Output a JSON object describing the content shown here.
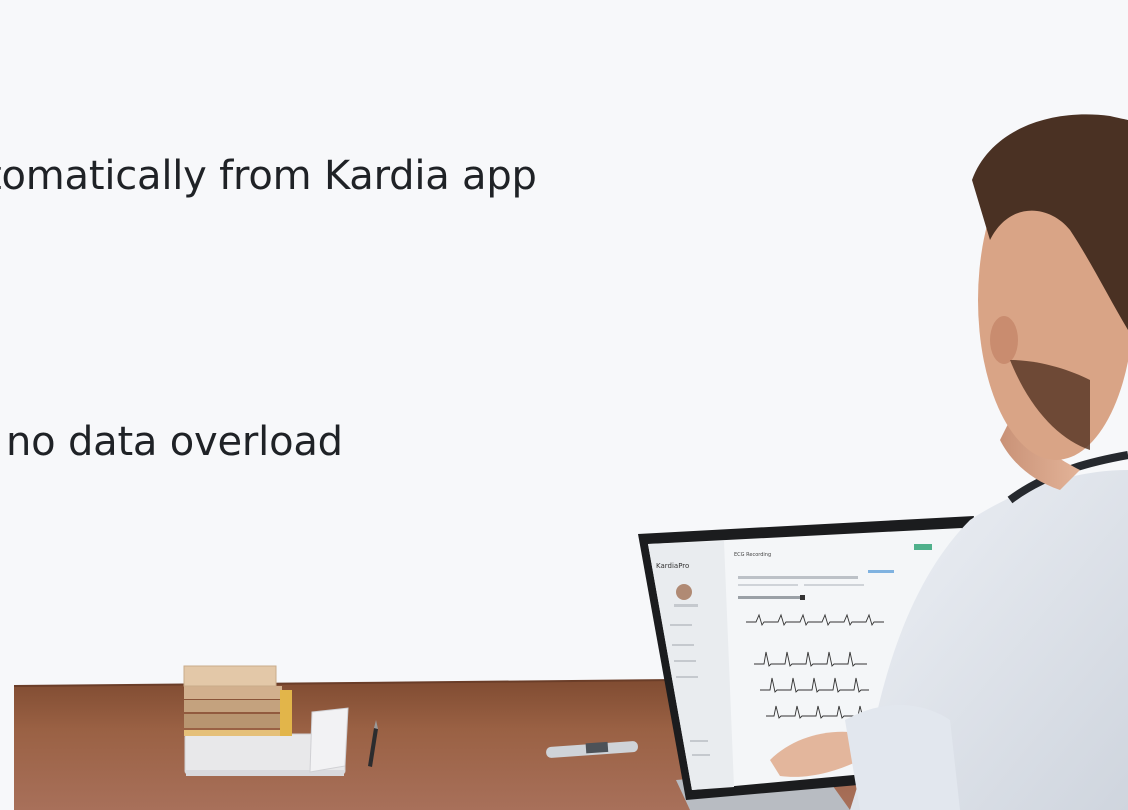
{
  "headlines": [
    "tomatically from Kardia app",
    "no data overload"
  ],
  "laptop_screen": {
    "app_name": "KardiaPro",
    "page_title": "ECG Recording"
  },
  "colors": {
    "background": "#f7f8fa",
    "text": "#1f2226",
    "desk": "#8a5338",
    "shirt": "#e9edf3",
    "hair": "#4a3123"
  }
}
